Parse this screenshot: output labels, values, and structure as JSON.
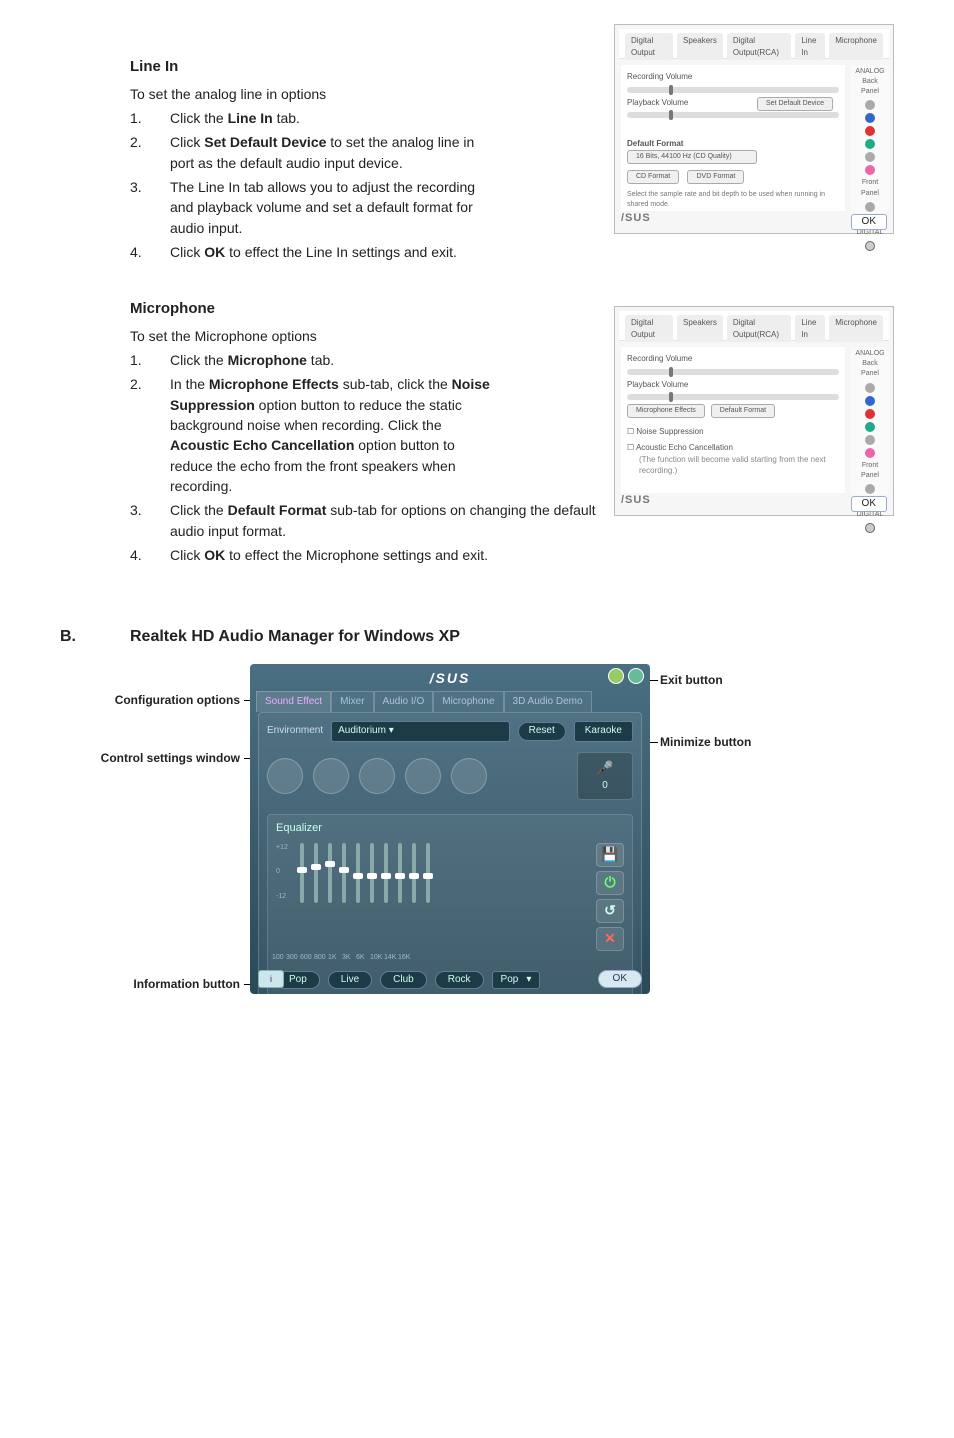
{
  "lineIn": {
    "heading": "Line In",
    "intro": "To set the analog line in options",
    "steps": [
      {
        "num": "1.",
        "pre": "Click the ",
        "bold": "Line In",
        "post": " tab."
      },
      {
        "num": "2.",
        "pre": "Click ",
        "bold": "Set Default Device",
        "post": " to set the analog line in port as the default audio input device."
      },
      {
        "num": "3.",
        "plain": "The Line In tab allows you to adjust the recording and playback volume and set a default format for audio input."
      },
      {
        "num": "4.",
        "pre": "Click ",
        "bold": "OK",
        "post": " to effect the Line In settings and exit."
      }
    ],
    "shot": {
      "tabs": [
        "Digital Output",
        "Speakers",
        "Digital Output(RCA)",
        "Line In",
        "Microphone"
      ],
      "recordingVolume": "Recording Volume",
      "playbackVolume": "Playback Volume",
      "setDefault": "Set Default Device",
      "defaultFormat": "Default Format",
      "formatValue": "16 Bits, 44100 Hz (CD Quality)",
      "cdFormat": "CD Format",
      "dvdFormat": "DVD Format",
      "note": "Select the sample rate and bit depth to be used when running in shared mode.",
      "analog": "ANALOG",
      "backPanel": "Back Panel",
      "frontPanel": "Front Panel",
      "digital": "DIGITAL",
      "ok": "OK",
      "brand": "/SUS"
    }
  },
  "mic": {
    "heading": "Microphone",
    "intro": "To set the Microphone options",
    "steps": [
      {
        "num": "1.",
        "pre": "Click the ",
        "bold": "Microphone",
        "post": " tab."
      },
      {
        "num": "2.",
        "pre": "In the ",
        "bold": "Microphone Effects",
        "post1": " sub-tab, click the ",
        "bold2": "Noise Suppression",
        "post2": " option button to reduce the static background noise when recording. Click the ",
        "bold3": "Acoustic Echo Cancellation",
        "post3": " option button to reduce the echo from the front speakers when recording."
      },
      {
        "num": "3.",
        "pre": "Click the ",
        "bold": "Default Format",
        "post": " sub-tab for options on changing the default audio input format."
      },
      {
        "num": "4.",
        "pre": "Click ",
        "bold": "OK",
        "post": " to effect the Microphone settings and exit."
      }
    ],
    "shot": {
      "tabs": [
        "Digital Output",
        "Speakers",
        "Digital Output(RCA)",
        "Line In",
        "Microphone"
      ],
      "recordingVolume": "Recording Volume",
      "playbackVolume": "Playback Volume",
      "subTabs": [
        "Microphone Effects",
        "Default Format"
      ],
      "noiseSuppression": "Noise Suppression",
      "aec": "Acoustic Echo Cancellation",
      "aecNote": "(The function will become valid starting from the next recording.)",
      "analog": "ANALOG",
      "backPanel": "Back Panel",
      "frontPanel": "Front Panel",
      "digital": "DIGITAL",
      "ok": "OK",
      "brand": "/SUS"
    }
  },
  "sectionB": {
    "letter": "B.",
    "title": "Realtek HD Audio Manager for Windows XP",
    "labels": {
      "config": "Configuration options",
      "control": "Control settings window",
      "info": "Information button",
      "exit": "Exit button",
      "minimize": "Minimize button"
    },
    "xp": {
      "logo": "/SUS",
      "tabs": [
        "Sound Effect",
        "Mixer",
        "Audio I/O",
        "Microphone",
        "3D Audio Demo"
      ],
      "environment": "Environment",
      "envValue": "Auditorium",
      "reset": "Reset",
      "karaoke": "Karaoke",
      "karaokeVal": "0",
      "equalizer": "Equalizer",
      "bands": [
        "100",
        "300",
        "600",
        "800",
        "1K",
        "3K",
        "6K",
        "10K",
        "14K",
        "16K"
      ],
      "presets": [
        "Pop",
        "Live",
        "Club",
        "Rock"
      ],
      "presetDropdown": "Pop",
      "ok": "OK",
      "eqSide": {
        "save": "",
        "power": "⏻",
        "reset": "↺",
        "close": "✕"
      },
      "scaleTicks": [
        "+12",
        "0",
        "-12"
      ]
    }
  }
}
